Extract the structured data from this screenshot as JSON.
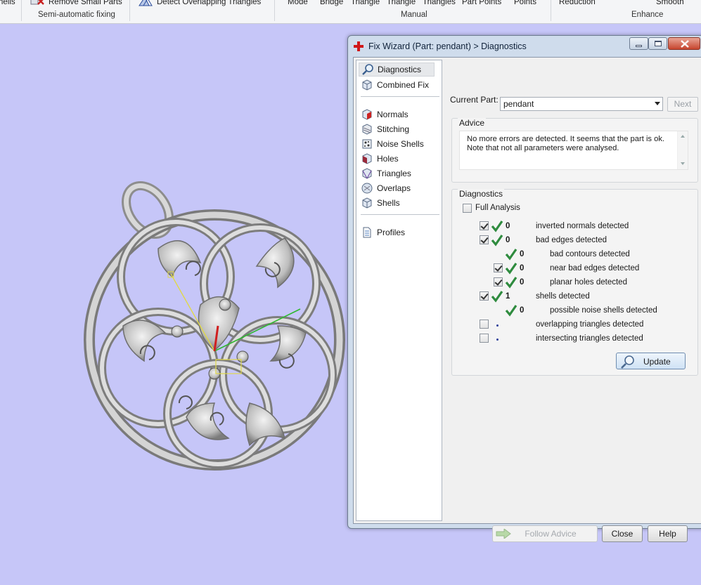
{
  "ribbon": {
    "top_labels": [
      "hells",
      "Remove Small Parts",
      "Detect Overlapping Triangles",
      "Mode",
      "Bridge",
      "Triangle",
      "Triangle",
      "Triangles",
      "Part Points",
      "Points",
      "Reduction",
      "Smooth"
    ],
    "groups": [
      "Semi-automatic fixing",
      "Manual",
      "Enhance"
    ]
  },
  "window": {
    "title": "Fix Wizard (Part: pendant) > Diagnostics",
    "caption_buttons": [
      "minimize",
      "maximize",
      "close"
    ]
  },
  "nav": {
    "items": [
      {
        "label": "Diagnostics",
        "icon": "magnifier-icon",
        "selected": true
      },
      {
        "label": "Combined Fix",
        "icon": "cube-icon"
      },
      {
        "label": "Normals",
        "icon": "normals-cube-icon"
      },
      {
        "label": "Stitching",
        "icon": "stitching-cube-icon"
      },
      {
        "label": "Noise Shells",
        "icon": "noise-shells-icon"
      },
      {
        "label": "Holes",
        "icon": "holes-cube-icon"
      },
      {
        "label": "Triangles",
        "icon": "triangles-cube-icon"
      },
      {
        "label": "Overlaps",
        "icon": "overlaps-icon"
      },
      {
        "label": "Shells",
        "icon": "shells-cube-icon"
      },
      {
        "label": "Profiles",
        "icon": "document-icon"
      }
    ]
  },
  "current_part": {
    "label": "Current Part:",
    "value": "pendant",
    "next": "Next"
  },
  "advice": {
    "title": "Advice",
    "line1": "No more errors are detected. It seems that the part is ok.",
    "line2": "Note that not all parameters were analysed."
  },
  "diagnostics": {
    "title": "Diagnostics",
    "full_analysis": "Full Analysis",
    "rows": [
      {
        "label": "inverted normals detected",
        "value": "0",
        "checkbox": true,
        "checked": true,
        "ok": true,
        "indent": 0
      },
      {
        "label": "bad edges detected",
        "value": "0",
        "checkbox": true,
        "checked": true,
        "ok": true,
        "indent": 0
      },
      {
        "label": "bad contours detected",
        "value": "0",
        "checkbox": false,
        "ok": true,
        "indent": 1
      },
      {
        "label": "near bad edges detected",
        "value": "0",
        "checkbox": true,
        "checked": true,
        "ok": true,
        "indent": 1
      },
      {
        "label": "planar holes detected",
        "value": "0",
        "checkbox": true,
        "checked": true,
        "ok": true,
        "indent": 1
      },
      {
        "label": "shells detected",
        "value": "1",
        "checkbox": true,
        "checked": true,
        "ok": true,
        "indent": 0
      },
      {
        "label": "possible noise shells detected",
        "value": "0",
        "checkbox": false,
        "ok": true,
        "indent": 1
      },
      {
        "label": "overlapping triangles detected",
        "value": "",
        "checkbox": true,
        "checked": false,
        "ok": false,
        "indent": 0
      },
      {
        "label": "intersecting triangles detected",
        "value": "",
        "checkbox": true,
        "checked": false,
        "ok": false,
        "indent": 0
      }
    ],
    "update": "Update"
  },
  "buttons": {
    "follow_advice": "Follow Advice",
    "close": "Close",
    "help": "Help"
  },
  "colors": {
    "viewport": "#c6c6f8",
    "tick": "#2e8b3e",
    "window_frame": "#cfdcec"
  }
}
